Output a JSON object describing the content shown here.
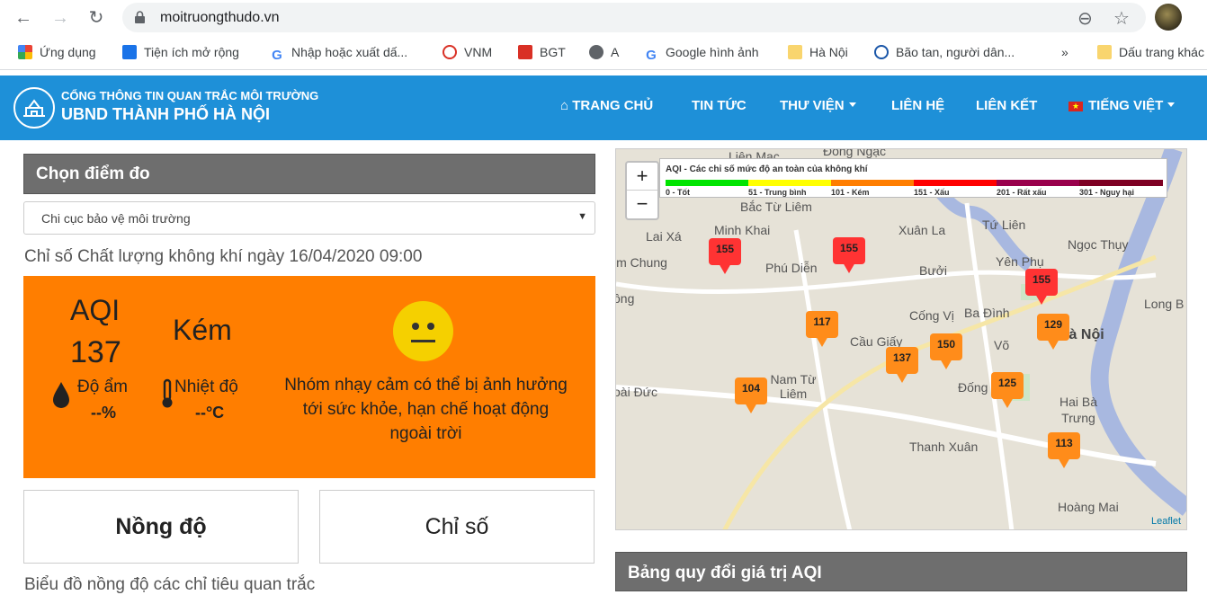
{
  "browser": {
    "url": "moitruongthudo.vn",
    "bookmarks": [
      {
        "label": "Ứng dụng",
        "icon": "apps-grid-icon"
      },
      {
        "label": "Tiện ích mở rộng",
        "icon": "puzzle-icon"
      },
      {
        "label": "Nhập hoặc xuất dấ...",
        "icon": "google-icon"
      },
      {
        "label": "VNM",
        "icon": "vnm-icon"
      },
      {
        "label": "BGT",
        "icon": "bgt-icon"
      },
      {
        "label": "A",
        "icon": "globe-icon"
      },
      {
        "label": "Google hình ảnh",
        "icon": "google-icon"
      },
      {
        "label": "Hà Nội",
        "icon": "folder-icon"
      },
      {
        "label": "Bão tan, người dân...",
        "icon": "news-icon"
      },
      {
        "label": "»",
        "icon": "more-icon"
      },
      {
        "label": "Dấu trang khác",
        "icon": "folder-icon"
      }
    ]
  },
  "header": {
    "line1": "CỔNG THÔNG TIN QUAN TRẮC MÔI TRƯỜNG",
    "line2": "UBND THÀNH PHỐ HÀ NỘI",
    "menu": [
      "TRANG CHỦ",
      "TIN TỨC",
      "THƯ VIỆN",
      "LIÊN HỆ",
      "LIÊN KẾT",
      "TIẾNG VIỆT"
    ]
  },
  "left": {
    "panel_title": "Chọn điểm đo",
    "selected_station": "Chi cục bảo vệ môi trường",
    "aqi_date": "Chỉ số Chất lượng không khí ngày 16/04/2020 09:00",
    "aqi_label": "AQI",
    "aqi_value": "137",
    "aqi_status": "Kém",
    "humidity_label": "Độ ẩm",
    "humidity_value": "--%",
    "temp_label": "Nhiệt độ",
    "temp_value": "--°C",
    "advice": "Nhóm nhạy cảm có thể bị ảnh hưởng tới sức khỏe, hạn chế hoạt động ngoài trời",
    "tab_concentration": "Nồng độ",
    "tab_index": "Chỉ số",
    "chart_title": "Biểu đồ nồng độ các chỉ tiêu quan trắc"
  },
  "map": {
    "zoom_in": "+",
    "zoom_out": "−",
    "legend_title": "AQI - Các chỉ số mức độ an toàn của không khí",
    "legend": [
      {
        "label": "0 - Tốt",
        "color": "#00e400"
      },
      {
        "label": "51 - Trung bình",
        "color": "#ffff00"
      },
      {
        "label": "101 - Kém",
        "color": "#ff7e00"
      },
      {
        "label": "151 - Xấu",
        "color": "#ff0000"
      },
      {
        "label": "201 - Rất xấu",
        "color": "#99004c"
      },
      {
        "label": "301 - Nguy hại",
        "color": "#7e0023"
      }
    ],
    "places": [
      "Đông Ngạc",
      "Liên Mạc",
      "Bắc Từ Liêm",
      "Lai Xá",
      "Minh Khai",
      "Xuân La",
      "Tứ Liên",
      "Ngọc Thụy",
      "im Chung",
      "Phú Diễn",
      "Bưởi",
      "Yên Phụ",
      "Long B",
      "ông",
      "Cống Vị",
      "Ba Đình",
      "Cầu Giấy",
      "Hà Nội",
      "Nam Từ Liêm",
      "oài Đức",
      "Đống",
      "Hai Bà Trưng",
      "Thanh Xuân",
      "Hoàng Mai",
      "Võ"
    ],
    "markers": [
      "155",
      "155",
      "155",
      "117",
      "129",
      "137",
      "150",
      "104",
      "125",
      "113"
    ],
    "attribution": "Leaflet"
  },
  "bottom_panel_title": "Bảng quy đổi giá trị AQI"
}
